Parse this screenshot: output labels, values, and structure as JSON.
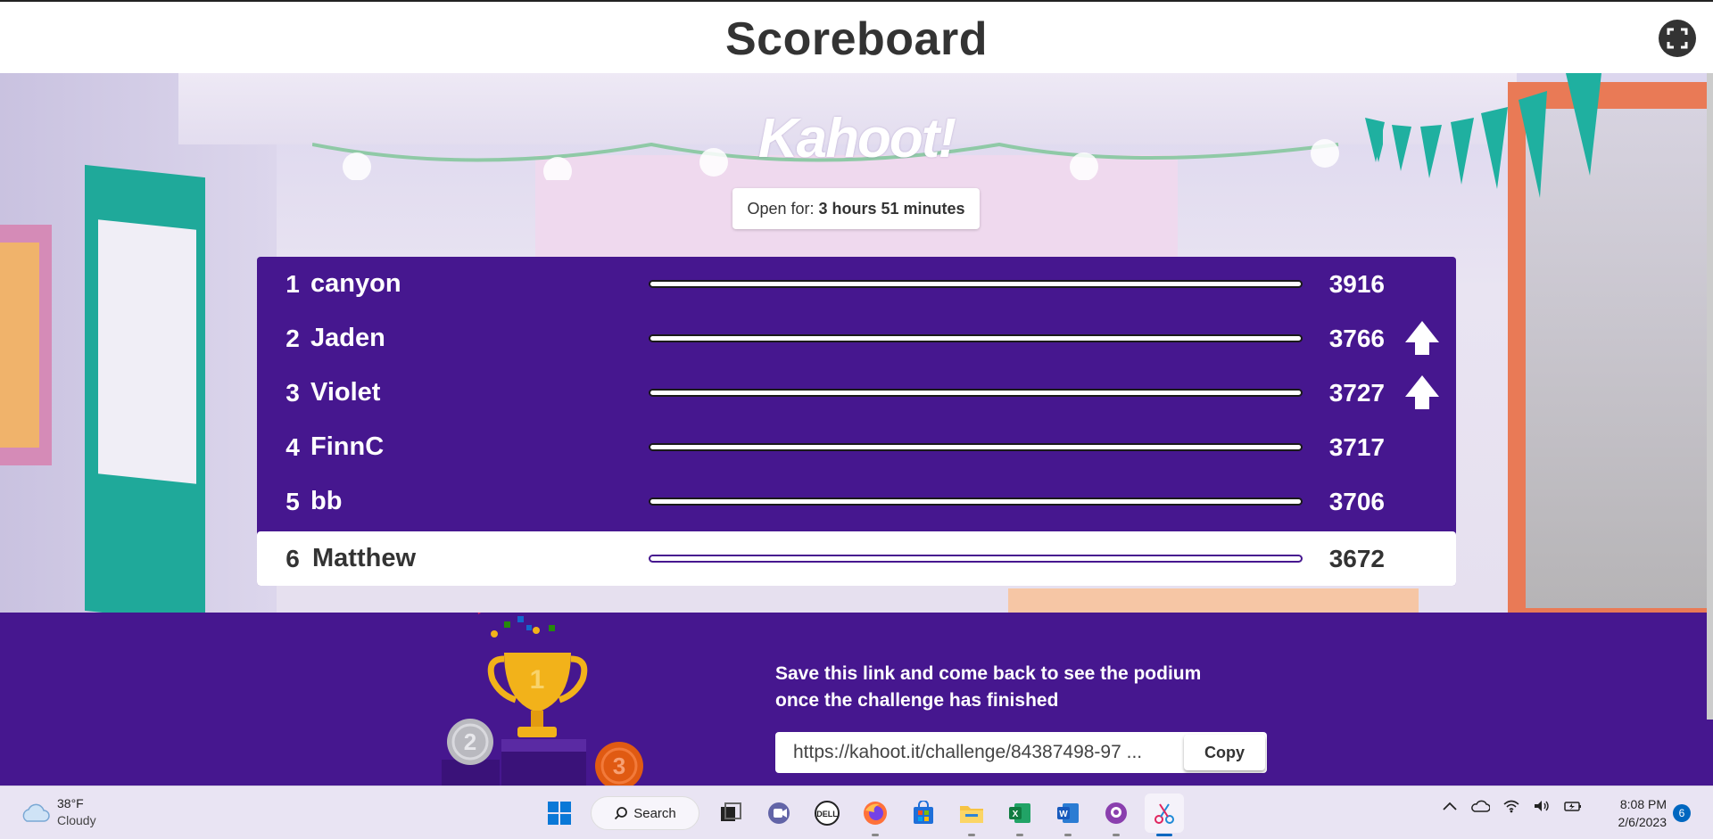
{
  "header": {
    "title": "Scoreboard"
  },
  "logo": {
    "text": "Kahoot!"
  },
  "open_for": {
    "label": "Open for:",
    "value": "3 hours 51 minutes"
  },
  "leaderboard": [
    {
      "rank": "1",
      "name": "canyon",
      "score": "3916",
      "moved_up": false,
      "current_user": false
    },
    {
      "rank": "2",
      "name": "Jaden",
      "score": "3766",
      "moved_up": true,
      "current_user": false
    },
    {
      "rank": "3",
      "name": "Violet",
      "score": "3727",
      "moved_up": true,
      "current_user": false
    },
    {
      "rank": "4",
      "name": "FinnC",
      "score": "3717",
      "moved_up": false,
      "current_user": false
    },
    {
      "rank": "5",
      "name": "bb",
      "score": "3706",
      "moved_up": false,
      "current_user": false
    },
    {
      "rank": "6",
      "name": "Matthew",
      "score": "3672",
      "moved_up": false,
      "current_user": true
    }
  ],
  "footer": {
    "save_line1": "Save this link and come back to see the podium",
    "save_line2": "once the challenge has finished",
    "link": "https://kahoot.it/challenge/84387498-97 ...",
    "copy_label": "Copy"
  },
  "podium": {
    "first": "1",
    "second": "2",
    "third": "3"
  },
  "taskbar": {
    "weather_temp": "38°F",
    "weather_desc": "Cloudy",
    "search_label": "Search",
    "time": "8:08 PM",
    "date": "2/6/2023",
    "notification_count": "6",
    "apps": [
      "windows-start",
      "task-view",
      "teams",
      "dell",
      "firefox",
      "microsoft-store",
      "file-explorer",
      "excel",
      "word",
      "github",
      "snipping-tool"
    ]
  },
  "colors": {
    "kahoot_purple": "#46178f",
    "podium_gold": "#f2b21a",
    "bronze": "#e05a12",
    "silver": "#b9b9bf"
  }
}
